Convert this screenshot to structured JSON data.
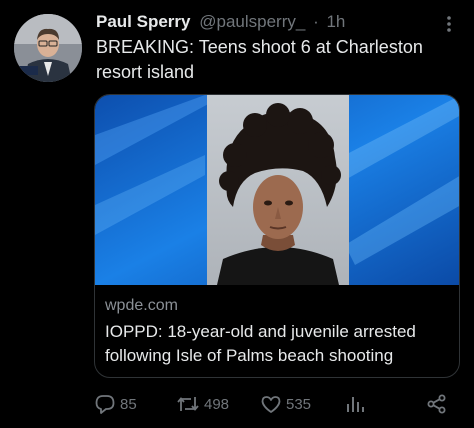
{
  "author": {
    "name": "Paul Sperry",
    "handle": "@paulsperry_",
    "separator": "·",
    "time": "1h"
  },
  "tweet": {
    "text": "BREAKING: Teens shoot 6 at Charleston resort island"
  },
  "card": {
    "domain": "wpde.com",
    "title": "IOPPD: 18-year-old and juvenile arrested following Isle of Palms beach shooting"
  },
  "actions": {
    "replies": "85",
    "reposts": "498",
    "likes": "535"
  },
  "icons": {
    "more": "more-vertical-icon",
    "reply": "reply-icon",
    "repost": "repost-icon",
    "like": "heart-icon",
    "views": "views-chart-icon",
    "share": "share-icon"
  },
  "colors": {
    "background": "#000000",
    "text_primary": "#e7e9ea",
    "text_secondary": "#71767b",
    "border": "#2f3336",
    "card_blue": "#1673d6"
  }
}
